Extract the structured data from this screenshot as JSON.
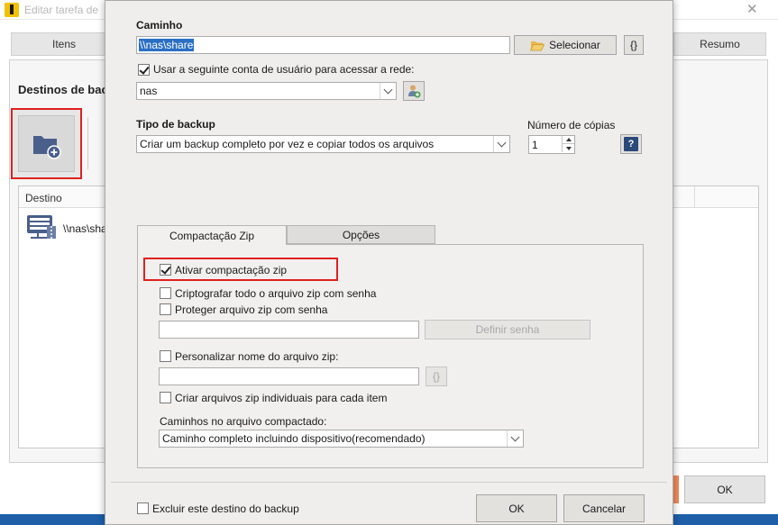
{
  "background": {
    "title": "Editar tarefa de",
    "tabs": [
      "Itens",
      "Resumo"
    ],
    "heading": "Destinos de bac",
    "list_header": "Destino",
    "list_item": "\\\\nas\\share",
    "ok_label": "OK"
  },
  "dialog": {
    "path_label": "Caminho",
    "path_value": "\\\\nas\\share",
    "select_button": "Selecionar",
    "braces_button": "{}",
    "use_account_label": "Usar a seguinte conta de usuário para acessar a rede:",
    "use_account_checked": true,
    "account_value": "nas",
    "backup_type_label": "Tipo de backup",
    "backup_type_value": "Criar um backup completo por vez e copiar todos os arquivos",
    "copies_label": "Número de cópias",
    "copies_value": "1",
    "help_glyph": "?",
    "tabs": [
      {
        "label": "Compactação Zip",
        "active": true
      },
      {
        "label": "Opções",
        "active": false
      }
    ],
    "zip": {
      "enable_label": "Ativar compactação zip",
      "enable_checked": true,
      "encrypt_label": "Criptografar todo o arquivo zip com senha",
      "encrypt_checked": false,
      "protect_label": "Proteger arquivo zip com senha",
      "protect_checked": false,
      "password_value": "",
      "set_password_button": "Definir senha",
      "custom_name_label": "Personalizar nome do arquivo zip:",
      "custom_name_checked": false,
      "name_value": "",
      "name_braces_button": "{}",
      "individual_label": "Criar arquivos zip individuais para cada item",
      "individual_checked": false,
      "paths_label": "Caminhos no arquivo compactado:",
      "paths_value": "Caminho completo incluindo dispositivo(recomendado)"
    },
    "exclude_label": "Excluir este destino do backup",
    "exclude_checked": false,
    "ok_button": "OK",
    "cancel_button": "Cancelar"
  },
  "colors": {
    "highlight_red": "#e02020",
    "selection_blue": "#2b6fc4",
    "folder_icon": "#4a5f8a"
  }
}
